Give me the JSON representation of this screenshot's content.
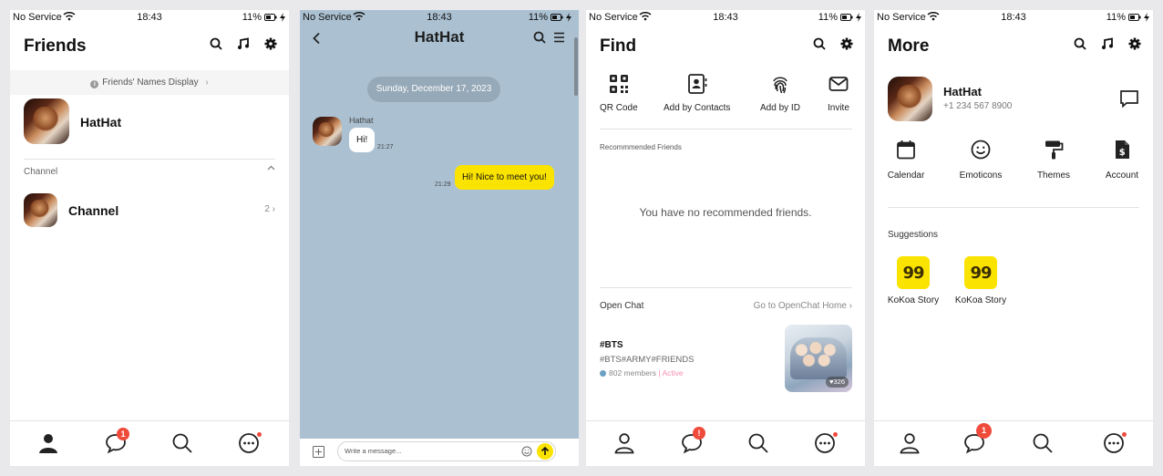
{
  "status": {
    "carrier": "No Service",
    "time": "18:43",
    "battery": "11%"
  },
  "friends": {
    "title": "Friends",
    "names_display": "Friends' Names Display",
    "profile_name": "HatHat",
    "channel_section": "Channel",
    "channel_name": "Channel",
    "channel_count": "2"
  },
  "chat": {
    "title": "HatHat",
    "date": "Sunday, December 17, 2023",
    "sender": "Hathat",
    "incoming_text": "Hi!",
    "incoming_time": "21:27",
    "outgoing_text": "Hi! Nice to meet you!",
    "outgoing_time": "21:29",
    "composer_placeholder": "Write a message..."
  },
  "find": {
    "title": "Find",
    "items": [
      {
        "label": "QR Code",
        "icon": "qr-code-icon"
      },
      {
        "label": "Add by Contacts",
        "icon": "contacts-icon"
      },
      {
        "label": "Add by ID",
        "icon": "fingerprint-icon"
      },
      {
        "label": "Invite",
        "icon": "mail-icon"
      }
    ],
    "recommended_label": "Recommmended Friends",
    "no_recommended": "You have no recommended friends.",
    "open_chat_label": "Open Chat",
    "open_chat_link": "Go to OpenChat Home",
    "openchat": {
      "tag": "#BTS",
      "tags": "#BTS#ARMY#FRIENDS",
      "members": "802 members",
      "separator": "|",
      "activity": "Active",
      "likes": "326"
    }
  },
  "more": {
    "title": "More",
    "profile_name": "HatHat",
    "phone": "+1 234 567 8900",
    "items": [
      {
        "label": "Calendar",
        "icon": "calendar-icon"
      },
      {
        "label": "Emoticons",
        "icon": "emoticon-icon"
      },
      {
        "label": "Themes",
        "icon": "paint-roller-icon"
      },
      {
        "label": "Account",
        "icon": "account-doc-icon"
      }
    ],
    "suggestions_label": "Suggestions",
    "suggestions": [
      {
        "label": "KoKoa Story",
        "glyph": "99"
      },
      {
        "label": "KoKoa Story",
        "glyph": "99"
      }
    ]
  },
  "tabbar": {
    "chat_badge": "1",
    "chat_badge_alt": "!"
  },
  "colors": {
    "accent_yellow": "#fbe300",
    "badge_red": "#f04a3b",
    "chat_bg": "#abc1d2",
    "active_pink": "#f48fb1"
  }
}
